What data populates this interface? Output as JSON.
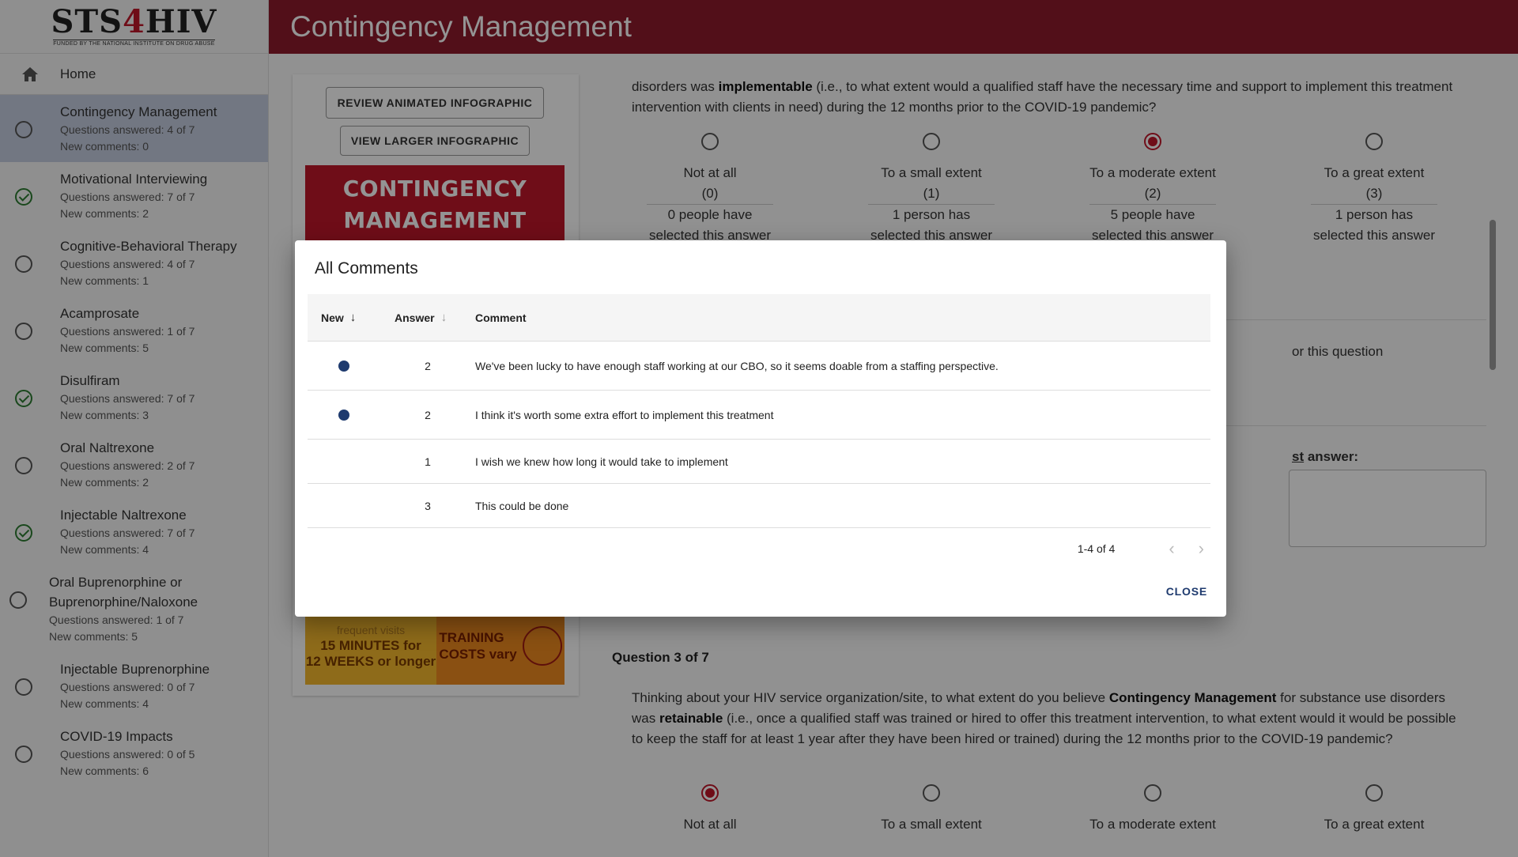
{
  "app": {
    "logo": {
      "text_left": "STS",
      "text_four": "4",
      "text_right": "HIV",
      "subtitle": "FUNDED BY THE NATIONAL INSTITUTE ON DRUG ABUSE"
    },
    "page_title": "Contingency Management",
    "accent_color": "#8e1a2c"
  },
  "sidebar": {
    "home_label": "Home",
    "items": [
      {
        "title": "Contingency Management",
        "answered": "Questions answered: 4 of 7",
        "comments": "New comments: 0",
        "status": "incomplete",
        "active": true
      },
      {
        "title": "Motivational Interviewing",
        "answered": "Questions answered: 7 of 7",
        "comments": "New comments: 2",
        "status": "complete"
      },
      {
        "title": "Cognitive-Behavioral Therapy",
        "answered": "Questions answered: 4 of 7",
        "comments": "New comments: 1",
        "status": "incomplete"
      },
      {
        "title": "Acamprosate",
        "answered": "Questions answered: 1 of 7",
        "comments": "New comments: 5",
        "status": "incomplete"
      },
      {
        "title": "Disulfiram",
        "answered": "Questions answered: 7 of 7",
        "comments": "New comments: 3",
        "status": "complete"
      },
      {
        "title": "Oral Naltrexone",
        "answered": "Questions answered: 2 of 7",
        "comments": "New comments: 2",
        "status": "incomplete"
      },
      {
        "title": "Injectable Naltrexone",
        "answered": "Questions answered: 7 of 7",
        "comments": "New comments: 4",
        "status": "complete"
      },
      {
        "title": "Oral Buprenorphine or Buprenorphine/Naloxone",
        "answered": "Questions answered: 1 of 7",
        "comments": "New comments: 5",
        "status": "incomplete"
      },
      {
        "title": "Injectable Buprenorphine",
        "answered": "Questions answered: 0 of 7",
        "comments": "New comments: 4",
        "status": "incomplete"
      },
      {
        "title": "COVID-19 Impacts",
        "answered": "Questions answered: 0 of 5",
        "comments": "New comments: 6",
        "status": "incomplete"
      }
    ]
  },
  "left_card": {
    "review_button": "REVIEW ANIMATED INFOGRAPHIC",
    "larger_button": "VIEW LARGER INFOGRAPHIC",
    "infographic_title_1": "CONTINGENCY",
    "infographic_title_2": "MANAGEMENT",
    "infographic_faded": "frequent visits",
    "infographic_minutes": "15 MINUTES for",
    "infographic_weeks": "12 WEEKS or longer",
    "infographic_training": "TRAINING",
    "infographic_costs": "COSTS vary"
  },
  "question2": {
    "text_prefix": "disorders was ",
    "text_bold": "implementable",
    "text_suffix": " (i.e., to what extent would a qualified staff have the necessary time and support to implement this treatment intervention with clients in need) during the 12 months prior to the COVID-19 pandemic?",
    "options": [
      {
        "label": "Not at all",
        "value": "(0)",
        "count_1": "0 people have",
        "count_2": "selected this answer",
        "selected": false
      },
      {
        "label": "To a small extent",
        "value": "(1)",
        "count_1": "1 person has",
        "count_2": "selected this answer",
        "selected": false
      },
      {
        "label": "To a moderate extent",
        "value": "(2)",
        "count_1": "5 people have",
        "count_2": "selected this answer",
        "selected": true
      },
      {
        "label": "To a great extent",
        "value": "(3)",
        "count_1": "1 person has",
        "count_2": "selected this answer",
        "selected": false
      }
    ],
    "partial_comment_text": "or this question",
    "partial_answer_prefix": "st",
    "partial_answer_suffix": " answer:"
  },
  "question3": {
    "heading": "Question 3 of 7",
    "text_1": "Thinking about your HIV service organization/site, to what extent do you believe ",
    "text_bold_1": "Contingency Management",
    "text_2": " for substance use disorders was ",
    "text_bold_2": "retainable",
    "text_3": " (i.e., once a qualified staff was trained or hired to offer this treatment intervention, to what extent would it would be possible to keep the staff for at least 1 year after they have been hired or trained) during the 12 months prior to the COVID-19 pandemic?",
    "options": [
      {
        "label": "Not at all",
        "selected": true
      },
      {
        "label": "To a small extent",
        "selected": false
      },
      {
        "label": "To a moderate extent",
        "selected": false
      },
      {
        "label": "To a great extent",
        "selected": false
      }
    ]
  },
  "modal": {
    "title": "All Comments",
    "columns": {
      "new": "New",
      "answer": "Answer",
      "comment": "Comment"
    },
    "rows": [
      {
        "is_new": true,
        "answer": "2",
        "comment": "We've been lucky to have enough staff working at our CBO, so it seems doable from a staffing perspective."
      },
      {
        "is_new": true,
        "answer": "2",
        "comment": "I think it's worth some extra effort to implement this treatment"
      },
      {
        "is_new": false,
        "answer": "1",
        "comment": "I wish we knew how long it would take to implement"
      },
      {
        "is_new": false,
        "answer": "3",
        "comment": "This could be done"
      }
    ],
    "pagination": "1-4 of 4",
    "close_label": "CLOSE"
  }
}
